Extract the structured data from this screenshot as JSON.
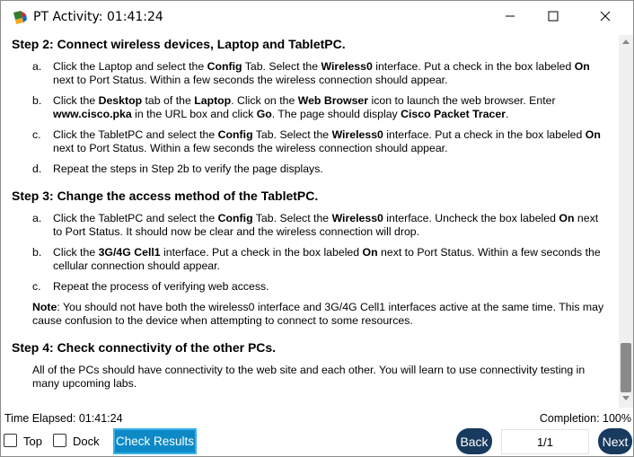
{
  "window": {
    "title": "PT Activity: 01:41:24",
    "icons": {
      "app": "packet-tracer-icon",
      "minimize": "minimize-icon",
      "maximize": "maximize-icon",
      "close": "close-icon"
    }
  },
  "content": {
    "step2": {
      "heading": "Step 2: Connect wireless devices, Laptop and TabletPC.",
      "items": [
        {
          "label": "a.",
          "parts": [
            "Click the Laptop and select the ",
            "Config",
            " Tab. Select the ",
            "Wireless0",
            " interface. Put a check in the box labeled ",
            "On",
            " next to Port Status. Within a few seconds the wireless connection should appear."
          ]
        },
        {
          "label": "b.",
          "parts": [
            "Click the ",
            "Desktop",
            " tab of the ",
            "Laptop",
            ". Click on the ",
            "Web Browser",
            " icon to launch the web browser. Enter ",
            "www.cisco.pka",
            " in the URL box and click ",
            "Go",
            ". The page should display ",
            "Cisco Packet Tracer",
            "."
          ]
        },
        {
          "label": "c.",
          "parts": [
            "Click the TabletPC and select the ",
            "Config",
            " Tab. Select the ",
            "Wireless0",
            " interface. Put a check in the box labeled ",
            "On",
            " next to Port Status. Within a few seconds the wireless connection should appear."
          ]
        },
        {
          "label": "d.",
          "parts": [
            "Repeat the steps in Step 2b to verify the page displays."
          ]
        }
      ]
    },
    "step3": {
      "heading": "Step 3: Change the access method of the TabletPC.",
      "items": [
        {
          "label": "a.",
          "parts": [
            "Click the TabletPC and select the ",
            "Config",
            " Tab. Select the ",
            "Wireless0",
            " interface. Uncheck the box labeled ",
            "On",
            " next to Port Status. It should now be clear and the wireless connection will drop."
          ]
        },
        {
          "label": "b.",
          "parts": [
            "Click the ",
            "3G/4G Cell1",
            " interface. Put a check in the box labeled ",
            "On",
            " next to Port Status. Within a few seconds the cellular connection should appear."
          ]
        },
        {
          "label": "c.",
          "parts": [
            "Repeat the process of verifying web access."
          ]
        }
      ],
      "note_label": "Note",
      "note_text": ": You should not have both the wireless0 interface and 3G/4G Cell1 interfaces active at the same time. This may cause confusion to the device when attempting to connect to some resources."
    },
    "step4": {
      "heading": "Step 4: Check connectivity of the other PCs.",
      "text": "All of the PCs should have connectivity to the web site and each other. You will learn to use connectivity testing in many upcoming labs."
    }
  },
  "status": {
    "elapsed": "Time Elapsed: 01:41:24",
    "completion": "Completion: 100%"
  },
  "controls": {
    "top_label": "Top",
    "dock_label": "Dock",
    "check_results": "Check Results",
    "back": "Back",
    "page": "1/1",
    "next": "Next",
    "top_checked": false,
    "dock_checked": false
  },
  "colors": {
    "check_results_bg": "#0d8ac6",
    "nav_button_bg": "#183a5e"
  }
}
